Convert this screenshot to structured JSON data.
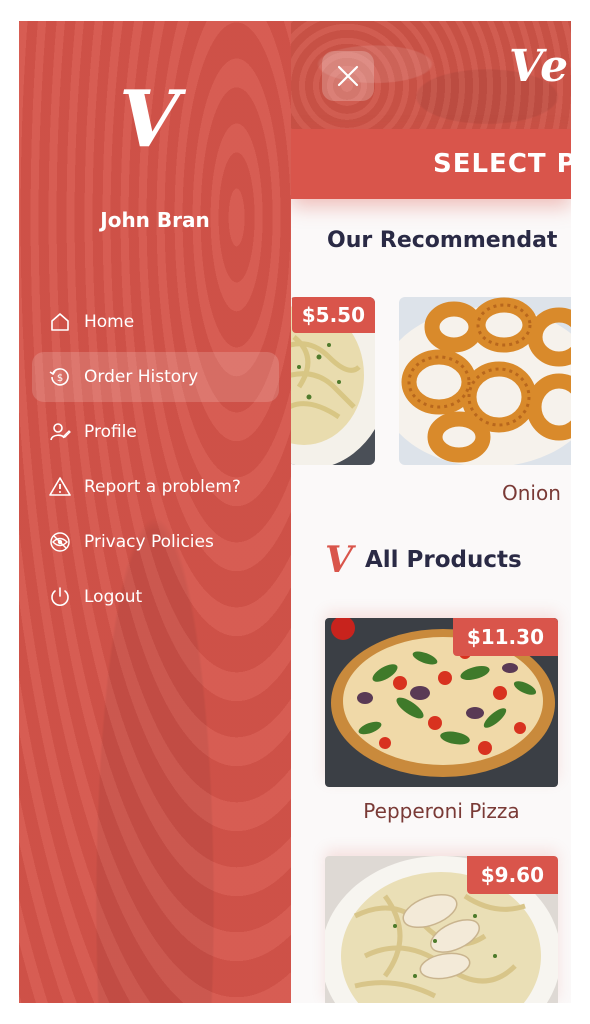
{
  "header": {
    "brand": "Ver",
    "close_label": "close",
    "banner": "SELECT PR"
  },
  "recommendations": {
    "title": "Our Recommendat",
    "items": [
      {
        "price": "$5.50",
        "name": ""
      },
      {
        "price": "",
        "name": "Onion"
      }
    ]
  },
  "all_products": {
    "title": "All Products",
    "items": [
      {
        "price": "$11.30",
        "name": "Pepperoni Pizza"
      },
      {
        "price": "$9.60",
        "name": ""
      }
    ]
  },
  "drawer": {
    "logo": "V",
    "user_name": "John Bran",
    "menu": [
      {
        "label": "Home",
        "icon": "home-icon",
        "active": false
      },
      {
        "label": "Order History",
        "icon": "order-history-icon",
        "active": true
      },
      {
        "label": "Profile",
        "icon": "profile-icon",
        "active": false
      },
      {
        "label": "Report a problem?",
        "icon": "warning-icon",
        "active": false
      },
      {
        "label": "Privacy Policies",
        "icon": "privacy-eye-icon",
        "active": false
      },
      {
        "label": "Logout",
        "icon": "power-icon",
        "active": false
      }
    ]
  },
  "colors": {
    "accent": "#d9554b",
    "drawer": "#d5544a",
    "heading": "#2a2a45",
    "product_name": "#7a3a36"
  }
}
